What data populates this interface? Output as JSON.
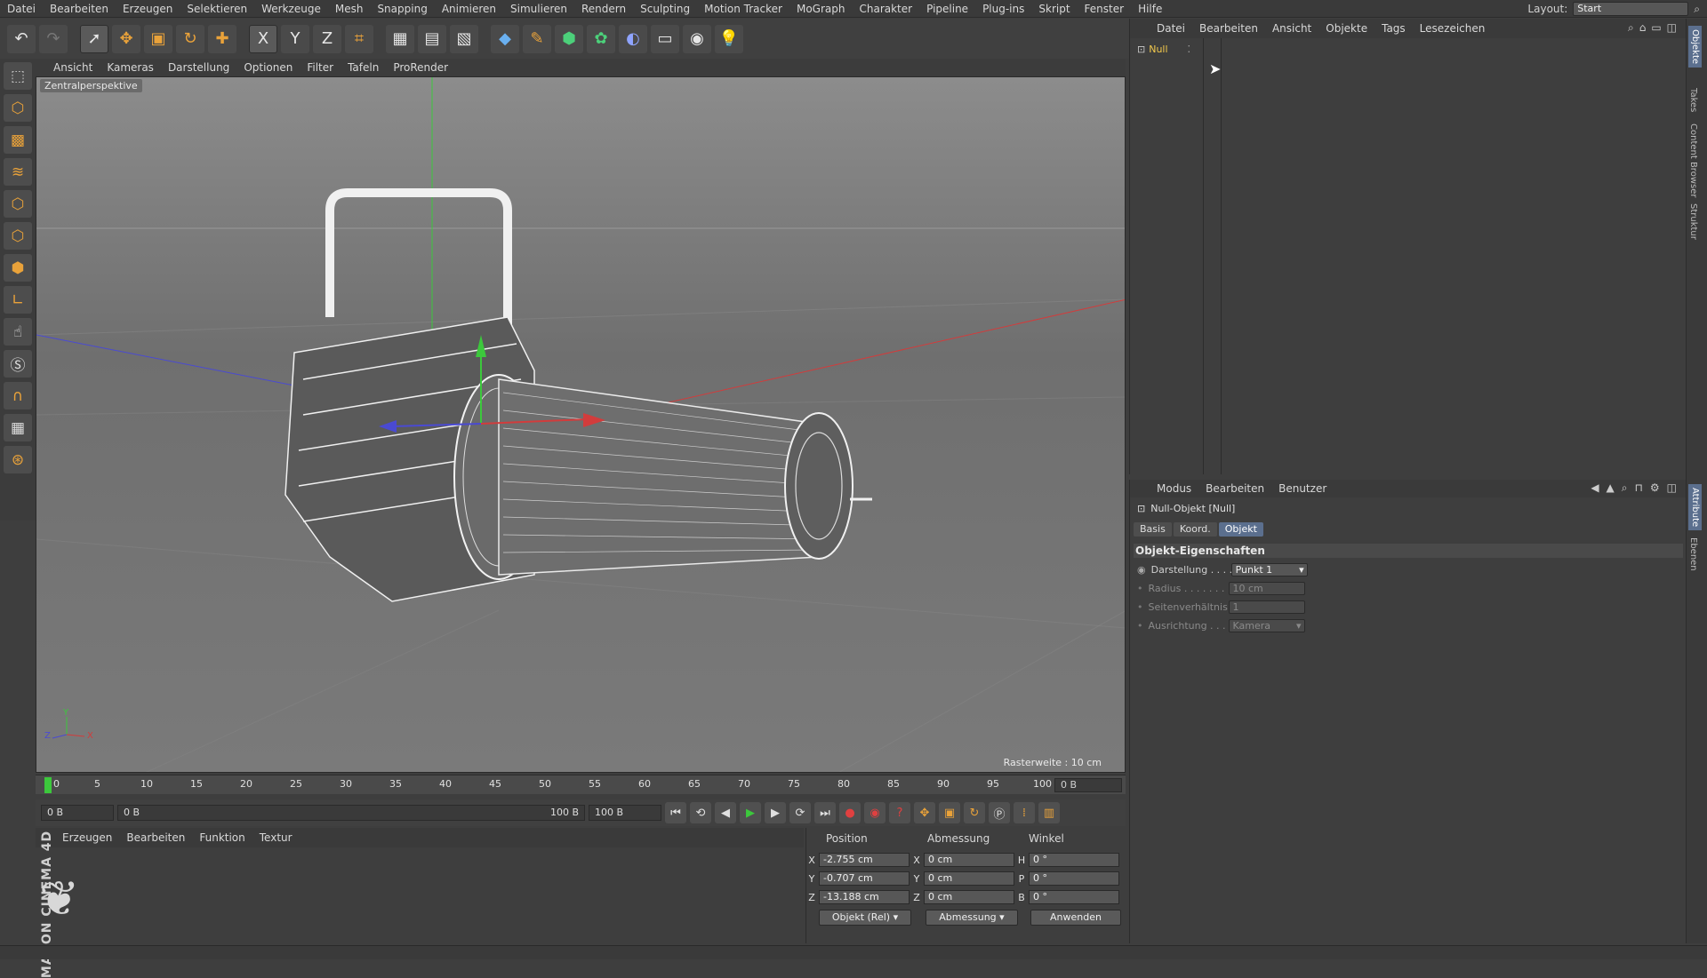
{
  "app": {
    "name": "Cinema 4D",
    "brand_lines": [
      "MAXON",
      "CINEMA 4D"
    ]
  },
  "menubar": {
    "items": [
      "Datei",
      "Bearbeiten",
      "Erzeugen",
      "Selektieren",
      "Werkzeuge",
      "Mesh",
      "Snapping",
      "Animieren",
      "Simulieren",
      "Rendern",
      "Sculpting",
      "Motion Tracker",
      "MoGraph",
      "Charakter",
      "Pipeline",
      "Plug-ins",
      "Skript",
      "Fenster",
      "Hilfe"
    ],
    "layout_label": "Layout:",
    "layout_value": "Start"
  },
  "toolbar": {
    "axis_x": "X",
    "axis_y": "Y",
    "axis_z": "Z",
    "icons": [
      "undo-icon",
      "redo-icon",
      "select-cursor-icon",
      "move-icon",
      "scale-icon",
      "rotate-icon",
      "live-select-icon",
      "axis-x-icon",
      "axis-y-icon",
      "axis-z-icon",
      "coordinate-system-icon",
      "render-view-icon",
      "render-picture-viewer-icon",
      "render-settings-icon",
      "cube-icon",
      "pen-icon",
      "subdivision-icon",
      "cloner-icon",
      "deformer-icon",
      "floor-icon",
      "camera-icon",
      "light-icon"
    ]
  },
  "viewport": {
    "menu": [
      "Ansicht",
      "Kameras",
      "Darstellung",
      "Optionen",
      "Filter",
      "Tafeln",
      "ProRender"
    ],
    "label": "Zentralperspektive",
    "raster": "Rasterweite : 10 cm",
    "axis_labels": {
      "y": "Y",
      "x": "X",
      "z": "Z"
    }
  },
  "timeline": {
    "ticks": [
      "0",
      "5",
      "10",
      "15",
      "20",
      "25",
      "30",
      "35",
      "40",
      "45",
      "50",
      "55",
      "60",
      "65",
      "70",
      "75",
      "80",
      "85",
      "90",
      "95",
      "100"
    ],
    "current_frame": "0 B"
  },
  "transport": {
    "start": "0 B",
    "range_start": "0 B",
    "range_end": "100 B",
    "end": "100 B"
  },
  "material_manager": {
    "menu": [
      "Erzeugen",
      "Bearbeiten",
      "Funktion",
      "Textur"
    ]
  },
  "coordinates": {
    "headers": [
      "Position",
      "Abmessung",
      "Winkel"
    ],
    "rows": [
      {
        "axis": "X",
        "pos": "-2.755 cm",
        "size_axis": "X",
        "size": "0 cm",
        "rot_axis": "H",
        "rot": "0 °"
      },
      {
        "axis": "Y",
        "pos": "-0.707 cm",
        "size_axis": "Y",
        "size": "0 cm",
        "rot_axis": "P",
        "rot": "0 °"
      },
      {
        "axis": "Z",
        "pos": "-13.188 cm",
        "size_axis": "Z",
        "size": "0 cm",
        "rot_axis": "B",
        "rot": "0 °"
      }
    ],
    "mode_select": "Objekt (Rel)",
    "size_select": "Abmessung",
    "apply_button": "Anwenden"
  },
  "object_manager": {
    "menu": [
      "Datei",
      "Bearbeiten",
      "Ansicht",
      "Objekte",
      "Tags",
      "Lesezeichen"
    ],
    "objects": [
      {
        "name": "Null"
      }
    ]
  },
  "attribute_manager": {
    "menu": [
      "Modus",
      "Bearbeiten",
      "Benutzer"
    ],
    "title": "Null-Objekt [Null]",
    "tabs": [
      "Basis",
      "Koord.",
      "Objekt"
    ],
    "active_tab": "Objekt",
    "section": "Objekt-Eigenschaften",
    "properties": [
      {
        "label": "Darstellung . . . .",
        "value": "Punkt 1",
        "enabled": true
      },
      {
        "label": "Radius . . . . . . . .",
        "value": "10 cm",
        "enabled": false
      },
      {
        "label": "Seitenverhältnis",
        "value": "1",
        "enabled": false
      },
      {
        "label": "Ausrichtung . . . .",
        "value": "Kamera",
        "enabled": false
      }
    ]
  },
  "side_tabs": [
    "Objekte",
    "Takes",
    "Content Browser",
    "Struktur",
    "Attribute",
    "Ebenen"
  ],
  "colors": {
    "accent_blue": "#5b6f8e",
    "tool_orange": "#e9a23a",
    "axis_x": "#d23c3c",
    "axis_y": "#3cc83c",
    "axis_z": "#4a4ad2",
    "null_label": "#f2c94c"
  }
}
